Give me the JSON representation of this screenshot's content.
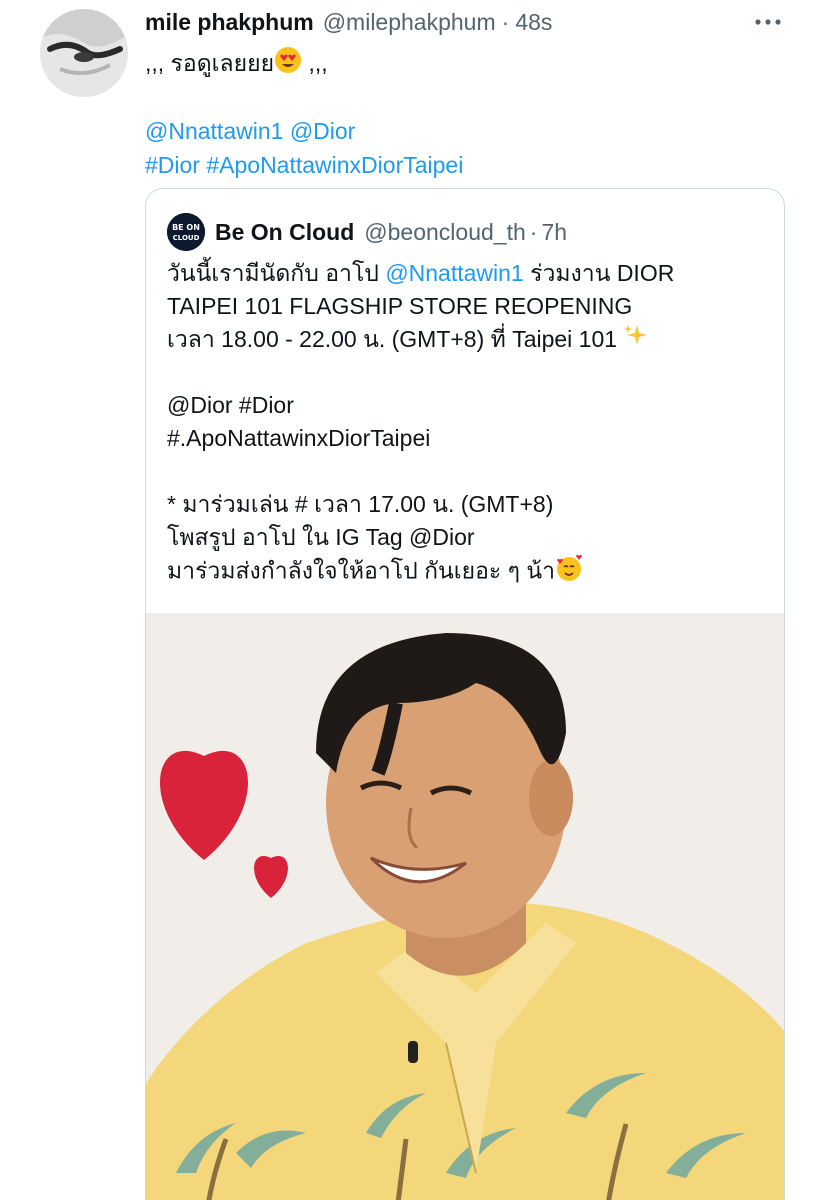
{
  "tweet": {
    "display_name": "mile phakphum",
    "handle": "@milephakphum",
    "separator": "·",
    "time": "48s",
    "body_text_before": ",,, รอดูเลยยย",
    "body_emoji": "heart-eyes-emoji",
    "body_text_after": " ,,,",
    "mention_1": "@Nnattawin1",
    "mention_2": "@Dior",
    "hashtag_1": "#Dior",
    "hashtag_2": "#ApoNattawinxDiorTaipei",
    "avatar_icon": "profile-photo",
    "more_icon": "more-dots-icon"
  },
  "quote": {
    "display_name": "Be On Cloud",
    "handle": "@beoncloud_th",
    "separator": "·",
    "time": "7h",
    "avatar_text_1": "BE ON",
    "avatar_text_2": "CLOUD",
    "line_1_text": "วันนี้เรามีนัดกับ อาโป ",
    "line_1_mention": "@Nnattawin1",
    "line_1_after": " ร่วมงาน DIOR",
    "line_2": "TAIPEI 101 FLAGSHIP STORE REOPENING",
    "line_3": "เวลา 18.00 - 22.00 น. (GMT+8) ที่ Taipei 101 ",
    "line_3_emoji": "sparkles-emoji",
    "mention_dior": "@Dior",
    "hashtag_dior": "#Dior",
    "hashtag_full": "#.ApoNattawinxDiorTaipei",
    "line_7": "* มาร่วมเล่น # เวลา 17.00 น. (GMT+8)",
    "line_8_text": "โพสรูป อาโป ใน IG Tag  ",
    "line_8_mention": "@Dior",
    "line_9": "มาร่วมส่งกำลังใจให้อาโป กันเยอะ ๆ น้า",
    "line_9_emoji": "smiling-face-with-hearts-emoji",
    "media_type": "gif-photo"
  },
  "colors": {
    "link": "#1d9bf0",
    "secondary_text": "#536471",
    "border": "#cfd9de",
    "heart": "#d9233b",
    "shirt": "#f3d77a"
  }
}
